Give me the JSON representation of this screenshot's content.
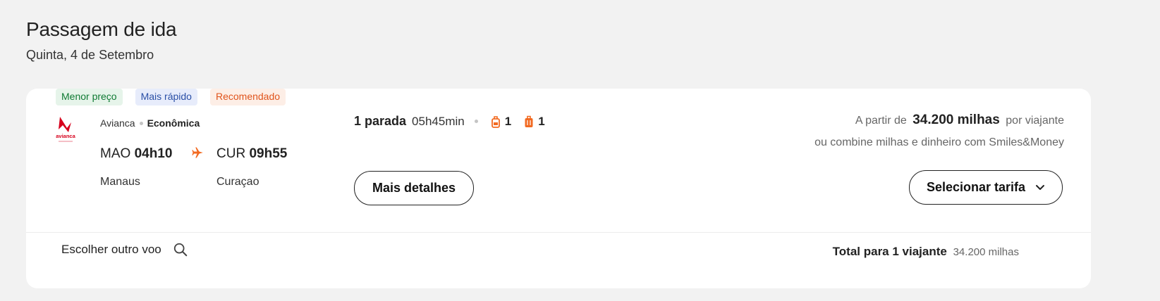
{
  "header": {
    "title": "Passagem de ida",
    "date": "Quinta, 4 de Setembro"
  },
  "badges": [
    {
      "label": "Menor preço",
      "color": "#0f7a33"
    },
    {
      "label": "Mais rápido",
      "color": "#2a4fa6"
    },
    {
      "label": "Recomendado",
      "color": "#e0541c"
    }
  ],
  "flight": {
    "airline": "Avianca",
    "cabin": "Econômica",
    "logo_text": "avianca",
    "origin_code": "MAO",
    "origin_time": "04h10",
    "origin_city": "Manaus",
    "dest_code": "CUR",
    "dest_time": "09h55",
    "dest_city": "Curaçao",
    "stops_label": "1 parada",
    "duration": "05h45min",
    "carry_on_count": "1",
    "checked_bag_count": "1"
  },
  "price": {
    "prefix": "A partir de",
    "amount": "34.200 milhas",
    "suffix": "por viajante",
    "combine_text": "ou combine milhas e dinheiro com Smiles&Money"
  },
  "buttons": {
    "details": "Mais detalhes",
    "select": "Selecionar tarifa"
  },
  "footer": {
    "other_flight": "Escolher outro voo",
    "total_label": "Total para 1 viajante",
    "total_amount": "34.200 milhas"
  },
  "colors": {
    "accent": "#f26a21",
    "brand_red": "#d6001c"
  },
  "icons": [
    "airplane-icon",
    "carry-on-bag-icon",
    "checked-bag-icon",
    "chevron-down-icon",
    "search-icon"
  ]
}
